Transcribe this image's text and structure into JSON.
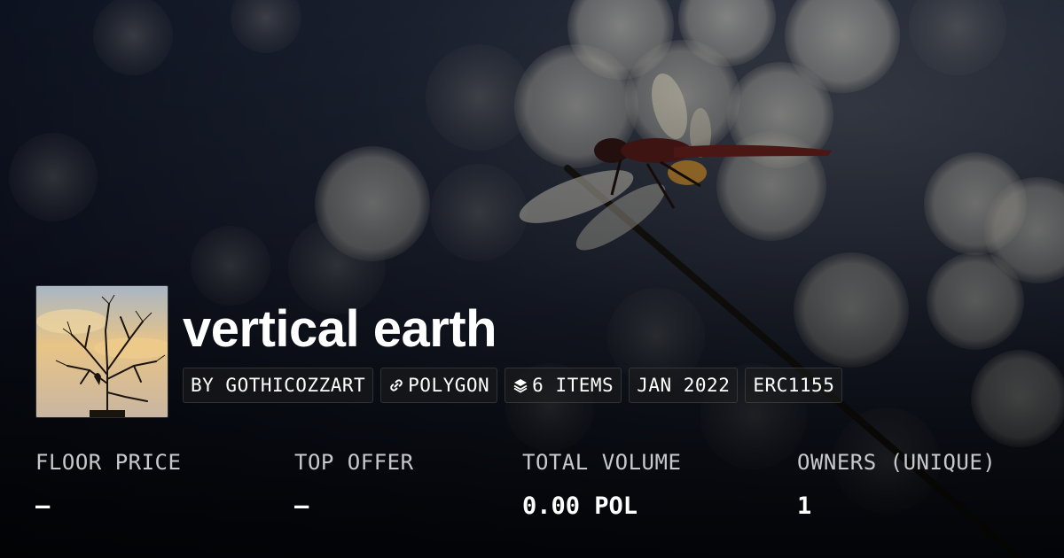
{
  "collection": {
    "title": "vertical earth",
    "tags": [
      {
        "label": "BY GOTHICOZZART",
        "icon": ""
      },
      {
        "label": "POLYGON",
        "icon": "chain-link-icon"
      },
      {
        "label": "6 ITEMS",
        "icon": "layers-icon"
      },
      {
        "label": "JAN 2022",
        "icon": ""
      },
      {
        "label": "ERC1155",
        "icon": ""
      }
    ]
  },
  "stats": [
    {
      "label": "FLOOR PRICE",
      "value": "–"
    },
    {
      "label": "TOP OFFER",
      "value": "–"
    },
    {
      "label": "TOTAL VOLUME",
      "value": "0.00 POL"
    },
    {
      "label": "OWNERS (UNIQUE)",
      "value": "1"
    }
  ],
  "colors": {
    "background": "#0d1220",
    "text": "#ffffff",
    "muted_text": "#c7c9cc",
    "tag_background": "#1e1e1e"
  }
}
